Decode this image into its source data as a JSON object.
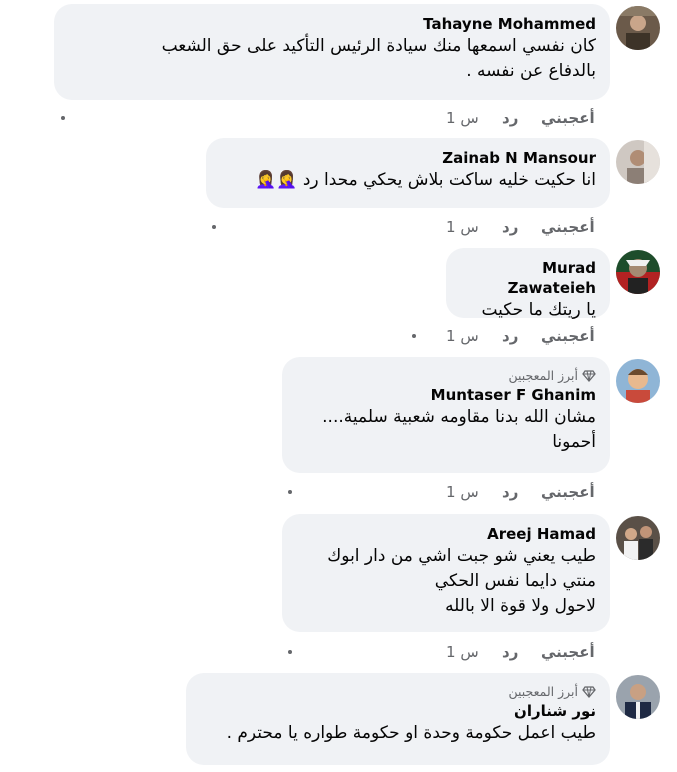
{
  "comments": [
    {
      "author": "Tahayne Mohammed",
      "badge": "",
      "text": "كان نفسي اسمعها منك سيادة الرئيس التأكيد على حق الشعب\nبالدفاع عن نفسه .",
      "like": "أعجبني",
      "reply": "رد",
      "time": "1 س"
    },
    {
      "author": "Zainab N Mansour",
      "badge": "",
      "text": "انا حكيت خليه ساكت بلاش يحكي محدا رد 🤦‍♀️🤦‍♀️",
      "like": "أعجبني",
      "reply": "رد",
      "time": "1 س"
    },
    {
      "author": "Murad Zawateieh",
      "badge": "",
      "text": "يا ريتك ما حكيت",
      "like": "أعجبني",
      "reply": "رد",
      "time": "1 س"
    },
    {
      "author": "Muntaser F Ghanim",
      "badge": "أبرز المعجبين",
      "text": "مشان الله بدنا مقاومه شعبية سلمية....\nأحمونا",
      "like": "أعجبني",
      "reply": "رد",
      "time": "1 س"
    },
    {
      "author": "Areej Hamad",
      "badge": "",
      "text": "طيب يعني شو جبت اشي من دار ابوك\nمنتي دايما نفس الحكي\nلاحول ولا قوة الا بالله",
      "like": "أعجبني",
      "reply": "رد",
      "time": "1 س"
    },
    {
      "author": "نور شناران",
      "badge": "أبرز المعجبين",
      "text": "طيب اعمل حكومة وحدة او حكومة طواره يا محترم .",
      "like": "",
      "reply": "",
      "time": ""
    }
  ],
  "colors": {
    "bubble": "#f0f2f5",
    "text": "#050505",
    "meta": "#65676b"
  },
  "icons": {
    "badge": "diamond-icon",
    "avatar": "avatar"
  }
}
